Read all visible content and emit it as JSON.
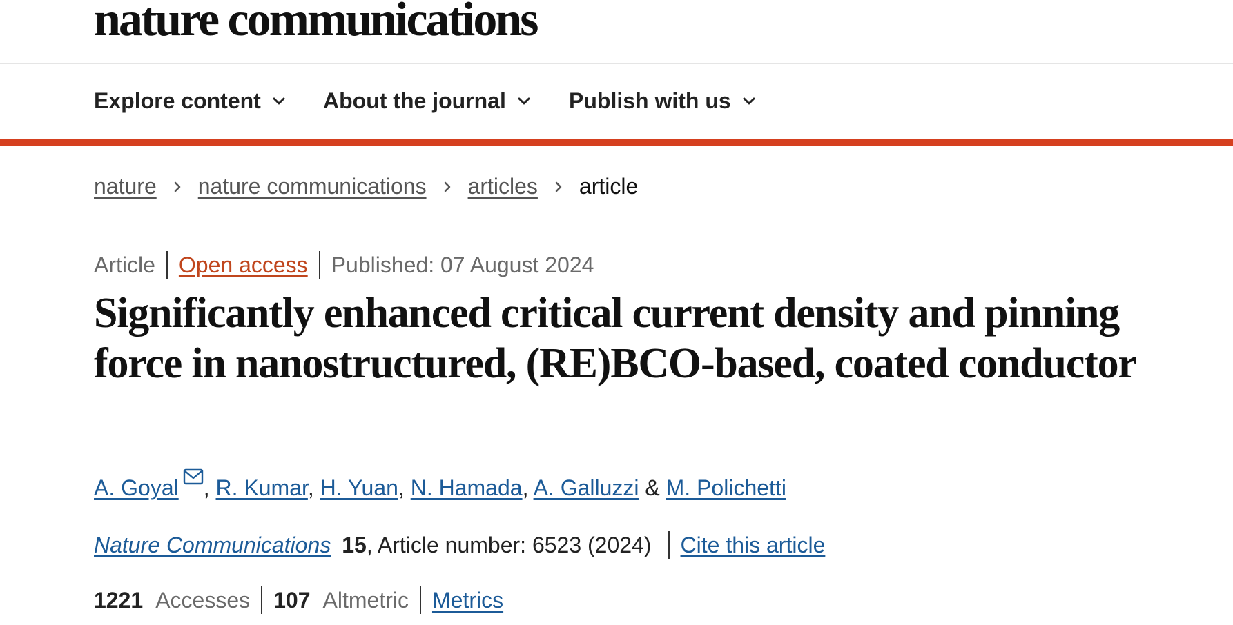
{
  "header": {
    "logo_text": "nature communications"
  },
  "nav": {
    "items": [
      {
        "label": "Explore content",
        "icon": "chevron-down-icon"
      },
      {
        "label": "About the journal",
        "icon": "chevron-down-icon"
      },
      {
        "label": "Publish with us",
        "icon": "chevron-down-icon"
      }
    ]
  },
  "colors": {
    "accent_rule": "#d5401f",
    "link": "#1c5b98",
    "open_access": "#c0461d"
  },
  "breadcrumb": {
    "items": [
      "nature",
      "nature communications",
      "articles"
    ],
    "current": "article",
    "separator_icon": "chevron-right-icon"
  },
  "article_meta": {
    "type": "Article",
    "access": "Open access",
    "published": "Published: 07 August 2024"
  },
  "article": {
    "title": "Significantly enhanced critical current density and pinning force in nanostructured, (RE)BCO-based, coated conductor"
  },
  "authors": {
    "list": [
      "A. Goyal",
      "R. Kumar",
      "H. Yuan",
      "N. Hamada",
      "A. Galluzzi",
      "M. Polichetti"
    ],
    "comma": ",",
    "amp": "&",
    "corresponding_icon": "mail-icon"
  },
  "citation": {
    "journal": "Nature Communications",
    "volume": "15",
    "details": ", Article number: 6523 (2024)",
    "cite_label": "Cite this article"
  },
  "metrics": {
    "accesses_count": "1221",
    "accesses_label": "Accesses",
    "altmetric_count": "107",
    "altmetric_label": "Altmetric",
    "metrics_link": "Metrics"
  }
}
